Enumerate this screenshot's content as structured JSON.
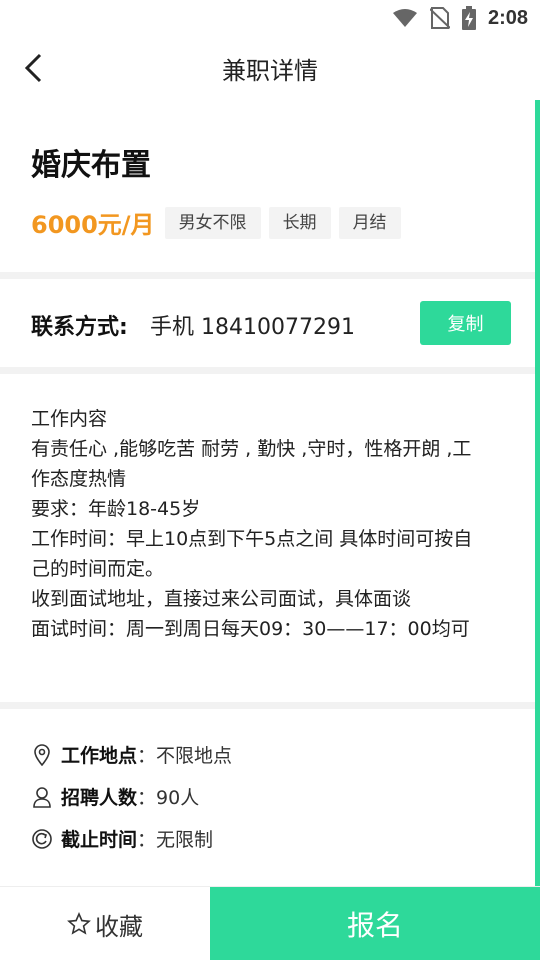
{
  "status_bar": {
    "time": "2:08",
    "icons": [
      "wifi-icon",
      "no-sim-icon",
      "battery-charging-icon"
    ]
  },
  "header": {
    "title": "兼职详情",
    "back_icon": "chevron-left-icon"
  },
  "job": {
    "title": "婚庆布置",
    "salary": "6000元/月",
    "tags": [
      "男女不限",
      "长期",
      "月结"
    ]
  },
  "contact": {
    "label": "联系方式:",
    "value": "手机 18410077291",
    "copy_label": "复制"
  },
  "description": {
    "lines": [
      "工作内容",
      "有责任心 ,能够吃苦 耐劳 , 勤快 ,守时，性格开朗 ,工",
      "作态度热情",
      "要求：年龄18-45岁",
      "工作时间：早上10点到下午5点之间 具体时间可按自",
      "己的时间而定。",
      "收到面试地址，直接过来公司面试，具体面谈",
      "面试时间：周一到周日每天09：30——17：00均可"
    ]
  },
  "info": {
    "location": {
      "icon": "location-pin-icon",
      "label": "工作地点",
      "value": "不限地点"
    },
    "headcount": {
      "icon": "person-icon",
      "label": "招聘人数",
      "value": "90人"
    },
    "deadline": {
      "icon": "clock-cycle-icon",
      "label": "截止时间",
      "value": "无限制"
    }
  },
  "bottom_bar": {
    "favorite_label": "收藏",
    "favorite_icon": "star-outline-icon",
    "apply_label": "报名"
  },
  "colors": {
    "accent_green": "#2ed99a",
    "salary_orange": "#f29720",
    "divider_gray": "#f2f2f2"
  }
}
